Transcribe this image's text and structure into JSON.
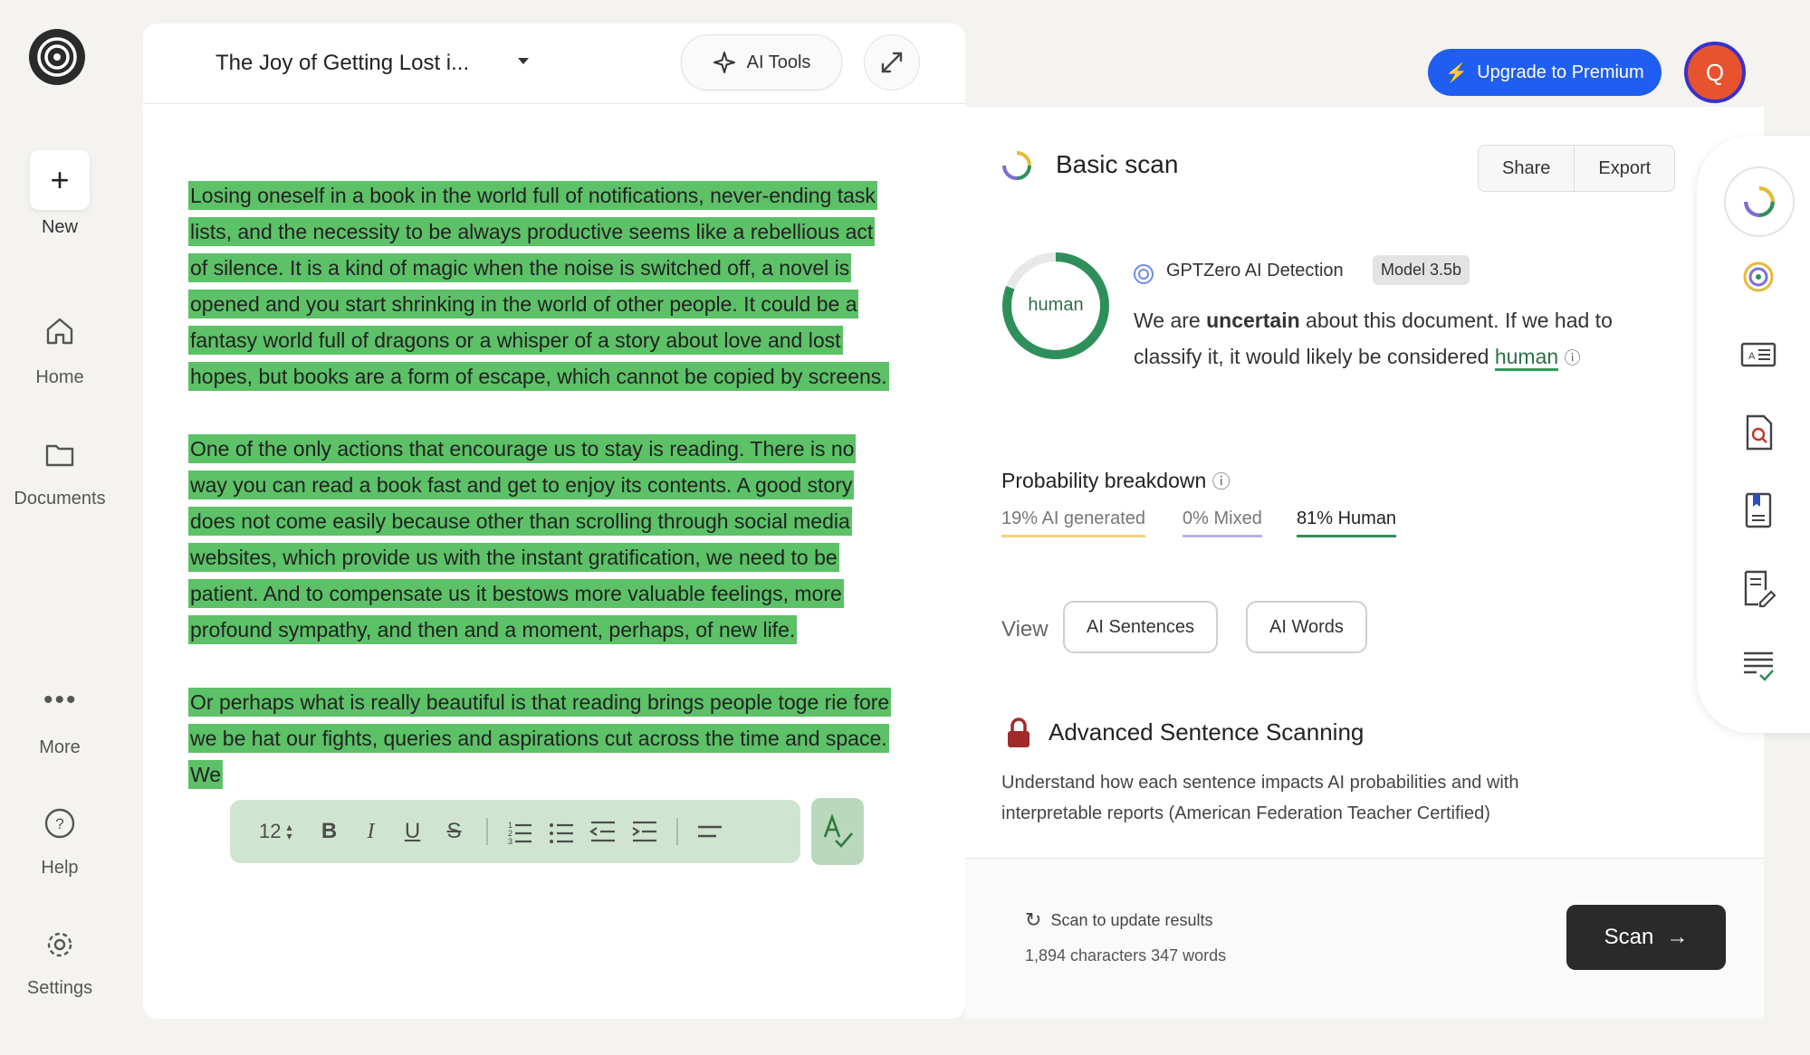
{
  "nav": {
    "new_label": "New",
    "home_label": "Home",
    "documents_label": "Documents",
    "more_label": "More",
    "help_label": "Help",
    "settings_label": "Settings"
  },
  "editor": {
    "doc_title": "The Joy of Getting Lost i...",
    "ai_tools_label": "AI Tools",
    "paragraphs": [
      "Losing oneself in a book in the world full of notifications, never-ending task lists, and the necessity to be always productive seems like a rebellious act of silence. It is a kind of magic when the noise is switched off, a novel is opened and you start shrinking in the world of other people. It could be a fantasy world full of dragons or a whisper of a story about love and lost hopes, but books are a form of escape, which cannot be copied by screens.",
      "One of the only actions that encourage us to stay is reading. There is no way you can read a book fast and get to enjoy its contents. A good story does not come easily because other than scrolling through social media websites, which provide us with the instant gratification, we need to be patient. And to compensate us it bestows more valuable feelings, more profound sympathy, and then and a moment, perhaps, of new life.",
      "Or perhaps what is really beautiful is that reading brings people toge                                        rie        fore we                                                            be      hat our fights, queries and aspirations cut across the time and space. We"
    ],
    "font_size": "12"
  },
  "header": {
    "upgrade_label": "Upgrade to Premium",
    "avatar_initial": "Q"
  },
  "scan": {
    "title": "Basic scan",
    "share_label": "Share",
    "export_label": "Export",
    "detection_label": "GPTZero AI Detection",
    "model_badge": "Model 3.5b",
    "gauge_label": "human",
    "verdict_prefix": "We are",
    "verdict_strong": "uncertain",
    "verdict_middle": "about this document. If we had to classify it, it would likely be considered",
    "verdict_result": "human",
    "probability_title": "Probability breakdown",
    "prob_ai": "19% AI generated",
    "prob_mixed": "0% Mixed",
    "prob_human": "81% Human",
    "human_fraction": 0.81,
    "view_label": "View",
    "ai_sentences_label": "AI Sentences",
    "ai_words_label": "AI Words",
    "advanced_title": "Advanced Sentence Scanning",
    "advanced_desc": "Understand how each sentence impacts AI probabilities and with interpretable reports (American Federation Teacher Certified)",
    "update_label": "Scan to update results",
    "counts_label": "1,894 characters 347 words",
    "scan_button_label": "Scan"
  },
  "colors": {
    "highlight": "#5cc167",
    "primary": "#1f5ef0",
    "human": "#2f8f5b",
    "ai": "#f0d27a",
    "mixed": "#b9b1e0"
  }
}
